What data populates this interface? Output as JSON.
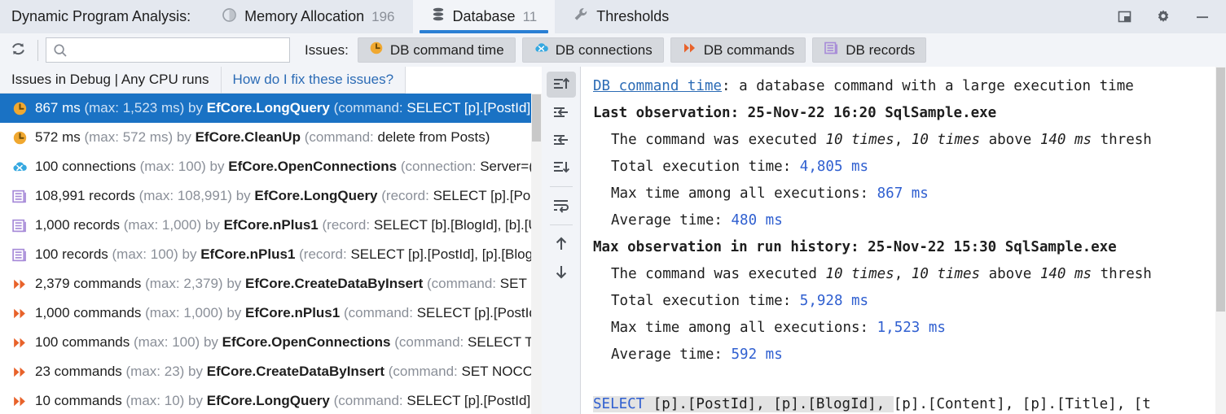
{
  "window": {
    "title": "Dynamic Program Analysis:",
    "controls": [
      {
        "name": "restore-window-button",
        "glyph": "restore"
      },
      {
        "name": "settings-button",
        "glyph": "gear"
      },
      {
        "name": "minimize-button",
        "glyph": "minimize"
      }
    ]
  },
  "tabs": [
    {
      "label": "Memory Allocation",
      "count": "196",
      "icon": "pie-chart-icon",
      "active": false
    },
    {
      "label": "Database",
      "count": "11",
      "icon": "database-icon",
      "active": true
    },
    {
      "label": "Thresholds",
      "count": "",
      "icon": "wrench-icon",
      "active": false
    }
  ],
  "toolbar": {
    "refresh_icon": "refresh-icon",
    "search": {
      "placeholder": "",
      "value": "",
      "icon": "search-icon"
    },
    "issues_label": "Issues:",
    "chips": [
      {
        "label": "DB command time",
        "icon": "clock-icon",
        "color": "#f0a830"
      },
      {
        "label": "DB connections",
        "icon": "connections-icon",
        "color": "#35a8e0"
      },
      {
        "label": "DB commands",
        "icon": "double-chevron-icon",
        "color": "#e8622a"
      },
      {
        "label": "DB records",
        "icon": "records-icon",
        "color": "#a78bd8"
      }
    ]
  },
  "list_header": {
    "title": "Issues in Debug | Any CPU runs",
    "help_link": "How do I fix these issues?"
  },
  "issues": [
    {
      "icon": "clock-icon",
      "value": "867 ms",
      "max": "(max: 1,523 ms)",
      "by": "by",
      "source": "EfCore.LongQuery",
      "detail_prefix": "(command:",
      "detail": "SELECT [p].[PostId],",
      "selected": true
    },
    {
      "icon": "clock-icon",
      "value": "572 ms",
      "max": "(max: 572 ms)",
      "by": "by",
      "source": "EfCore.CleanUp",
      "detail_prefix": "(command:",
      "detail": "delete from Posts)",
      "selected": false
    },
    {
      "icon": "connections-icon",
      "value": "100 connections",
      "max": "(max: 100)",
      "by": "by",
      "source": "EfCore.OpenConnections",
      "detail_prefix": "(connection:",
      "detail": "Server=(",
      "selected": false
    },
    {
      "icon": "records-icon",
      "value": "108,991 records",
      "max": "(max: 108,991)",
      "by": "by",
      "source": "EfCore.LongQuery",
      "detail_prefix": "(record:",
      "detail": "SELECT [p].[Post",
      "selected": false
    },
    {
      "icon": "records-icon",
      "value": "1,000 records",
      "max": "(max: 1,000)",
      "by": "by",
      "source": "EfCore.nPlus1",
      "detail_prefix": "(record:",
      "detail": "SELECT [b].[BlogId], [b].[U",
      "selected": false
    },
    {
      "icon": "records-icon",
      "value": "100 records",
      "max": "(max: 100)",
      "by": "by",
      "source": "EfCore.nPlus1",
      "detail_prefix": "(record:",
      "detail": "SELECT [p].[PostId], [p].[Blogl",
      "selected": false
    },
    {
      "icon": "double-chevron-icon",
      "value": "2,379 commands",
      "max": "(max: 2,379)",
      "by": "by",
      "source": "EfCore.CreateDataByInsert",
      "detail_prefix": "(command:",
      "detail": "SET N",
      "selected": false
    },
    {
      "icon": "double-chevron-icon",
      "value": "1,000 commands",
      "max": "(max: 1,000)",
      "by": "by",
      "source": "EfCore.nPlus1",
      "detail_prefix": "(command:",
      "detail": "SELECT [p].[PostId",
      "selected": false
    },
    {
      "icon": "double-chevron-icon",
      "value": "100 commands",
      "max": "(max: 100)",
      "by": "by",
      "source": "EfCore.OpenConnections",
      "detail_prefix": "(command:",
      "detail": "SELECT TO",
      "selected": false
    },
    {
      "icon": "double-chevron-icon",
      "value": "23 commands",
      "max": "(max: 23)",
      "by": "by",
      "source": "EfCore.CreateDataByInsert",
      "detail_prefix": "(command:",
      "detail": "SET NOCOU",
      "selected": false
    },
    {
      "icon": "double-chevron-icon",
      "value": "10 commands",
      "max": "(max: 10)",
      "by": "by",
      "source": "EfCore.LongQuery",
      "detail_prefix": "(command:",
      "detail": "SELECT [p].[PostId],",
      "selected": false
    }
  ],
  "side_tools": [
    {
      "name": "expand-all-button",
      "icon": "expand-up-icon",
      "active": true
    },
    {
      "name": "collapse-one-button",
      "icon": "collapse-left-icon",
      "active": false
    },
    {
      "name": "collapse-two-button",
      "icon": "collapse-left-icon",
      "active": false
    },
    {
      "name": "collapse-all-button",
      "icon": "collapse-down-icon",
      "active": false
    },
    {
      "name": "word-wrap-button",
      "icon": "wrap-text-icon",
      "active": false
    },
    {
      "name": "previous-issue-button",
      "icon": "arrow-up-icon",
      "active": false
    },
    {
      "name": "next-issue-button",
      "icon": "arrow-down-icon",
      "active": false
    }
  ],
  "detail": {
    "title_link": "DB command time",
    "title_rest": ": a database command with a large execution time",
    "last_observation_label": "Last observation:",
    "last_observation_value": "25-Nov-22 16:20 SqlSample.exe",
    "last": {
      "executed_pre": "The command was executed ",
      "executed_times": "10 times",
      "executed_mid": ", ",
      "above_times": "10 times",
      "above_mid": " above ",
      "threshold": "140 ms",
      "threshold_suffix": " thresh",
      "total_label": "Total execution time: ",
      "total_value": "4,805 ms",
      "max_label": "Max time among all executions: ",
      "max_value": "867 ms",
      "avg_label": "Average time: ",
      "avg_value": "480 ms"
    },
    "max_observation_label": "Max observation in run history:",
    "max_observation_value": "25-Nov-22 15:30 SqlSample.exe",
    "max": {
      "executed_pre": "The command was executed ",
      "executed_times": "10 times",
      "executed_mid": ", ",
      "above_times": "10 times",
      "above_mid": " above ",
      "threshold": "140 ms",
      "threshold_suffix": " thresh",
      "total_label": "Total execution time: ",
      "total_value": "5,928 ms",
      "max_label": "Max time among all executions: ",
      "max_value": "1,523 ms",
      "avg_label": "Average time: ",
      "avg_value": "592 ms"
    },
    "sql_keyword": "SELECT",
    "sql_highlight": " [p].[PostId], [p].[BlogId], ",
    "sql_rest": "[p].[Content], [p].[Title], [t"
  },
  "colors": {
    "accent": "#1a72c4",
    "tab_underline": "#2a7fd4",
    "link": "#2b6bb5",
    "number": "#2f5fd0",
    "chrome": "#e4e8ef",
    "panel": "#f2f4f8"
  }
}
